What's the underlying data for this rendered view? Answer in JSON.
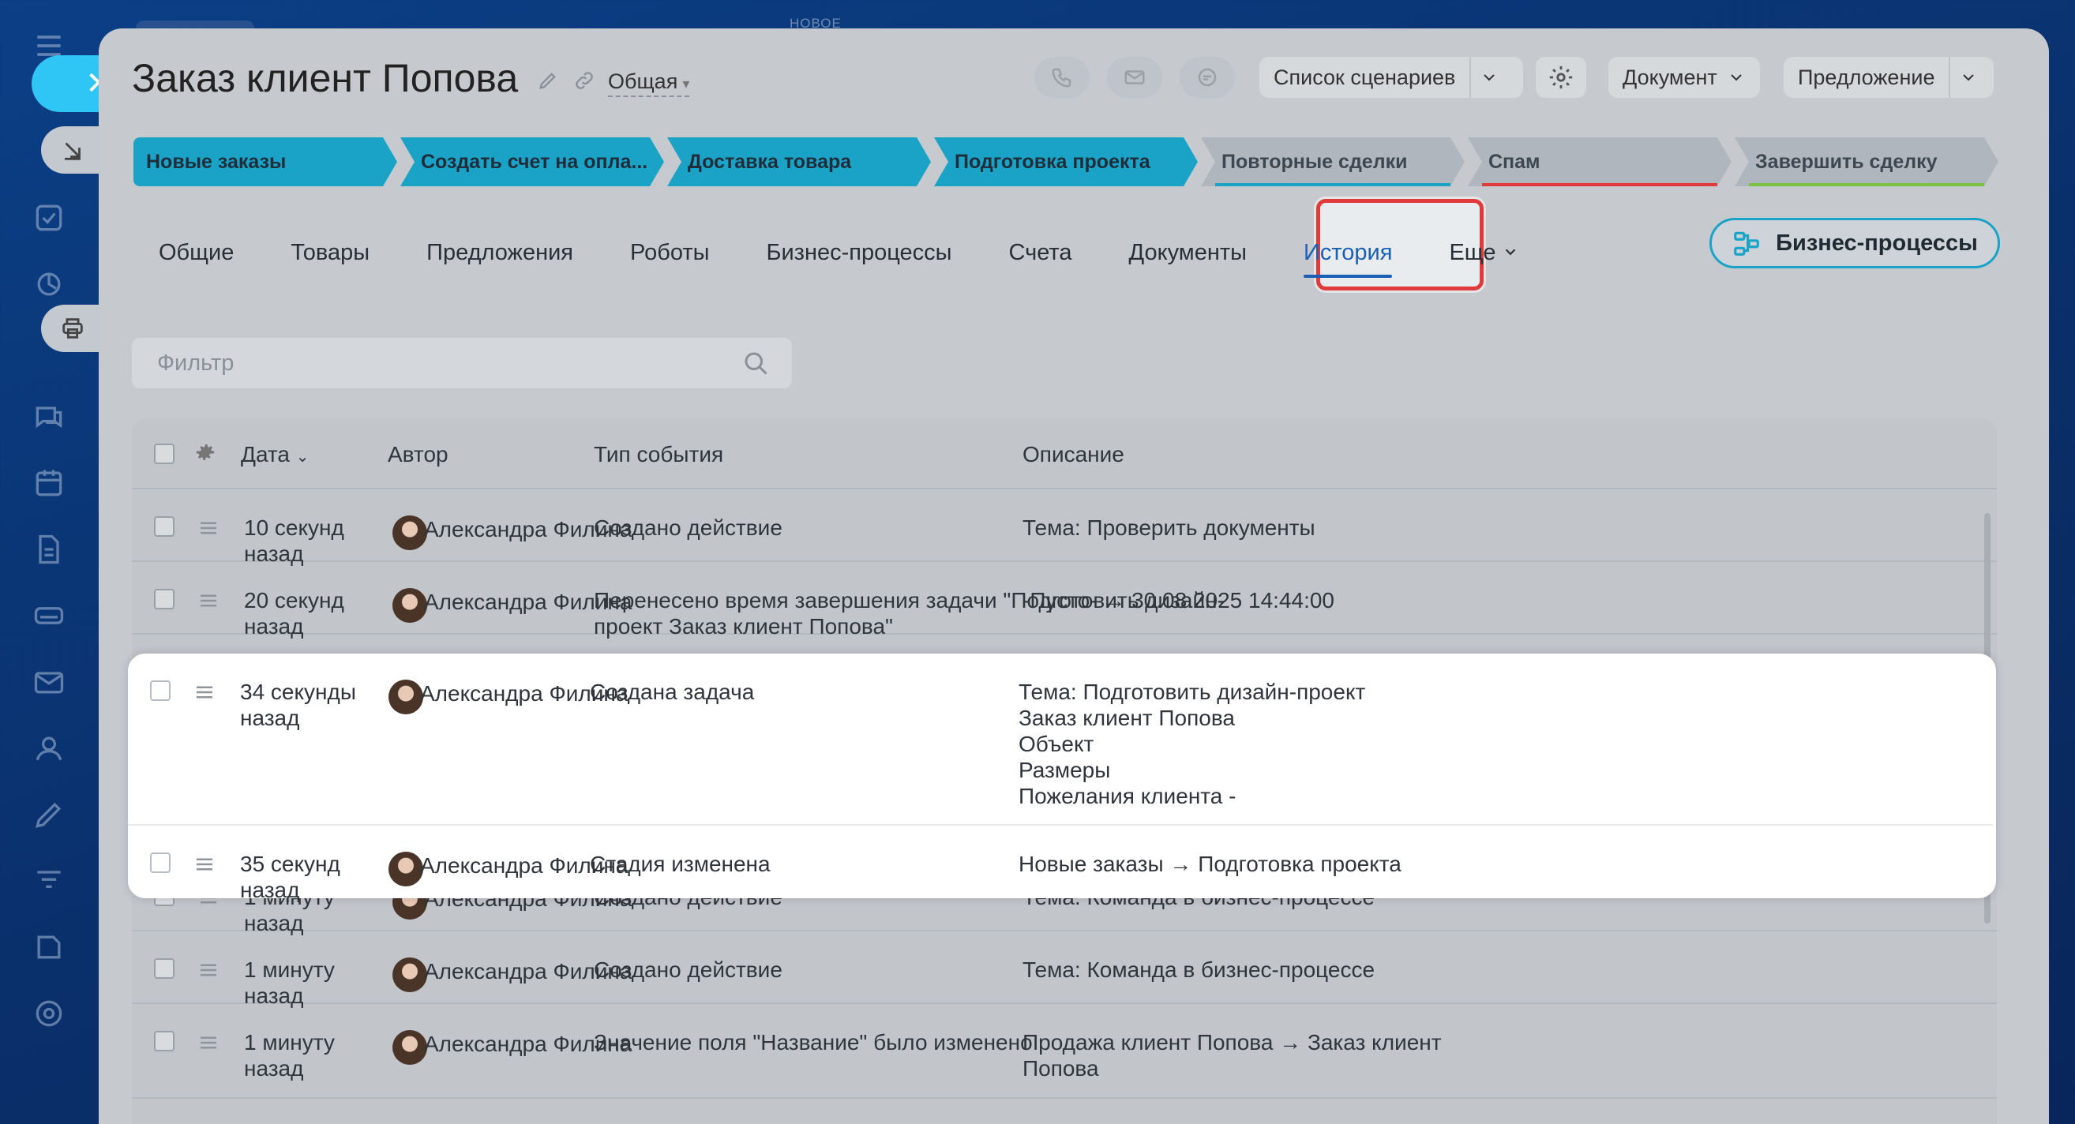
{
  "window": {
    "top_label": "НОВОЕ",
    "title": "Заказ клиент Попова",
    "category": "Общая"
  },
  "header_buttons": {
    "scenarios": "Список сценариев",
    "document": "Документ",
    "proposal": "Предложение"
  },
  "stages": [
    {
      "label": "Новые заказы",
      "state": "active"
    },
    {
      "label": "Создать счет на опла...",
      "state": "active"
    },
    {
      "label": "Доставка товара",
      "state": "active"
    },
    {
      "label": "Подготовка проекта",
      "state": "active"
    },
    {
      "label": "Повторные сделки",
      "state": "inactive",
      "underline": "#1aa3c7"
    },
    {
      "label": "Спам",
      "state": "inactive",
      "underline": "#e03a3a"
    },
    {
      "label": "Завершить сделку",
      "state": "inactive",
      "underline": "#7cc242"
    }
  ],
  "tabs": [
    "Общие",
    "Товары",
    "Предложения",
    "Роботы",
    "Бизнес-процессы",
    "Счета",
    "Документы",
    "История",
    "Еще"
  ],
  "selected_tab": "История",
  "bp_button": "Бизнес-процессы",
  "filter": {
    "placeholder": "Фильтр"
  },
  "table": {
    "columns": [
      "Дата",
      "Автор",
      "Тип события",
      "Описание"
    ],
    "rows": [
      {
        "date": "10 секунд назад",
        "author": "Александра Филина",
        "event": "Создано действие",
        "desc": "Тема: Проверить документы"
      },
      {
        "date": "20 секунд назад",
        "author": "Александра Филина",
        "event": "Перенесено время завершения задачи \"Подготовить дизайн-проект Заказ клиент Попова\"",
        "desc": "-Пусто- → 30.08.2025 14:44:00"
      },
      {
        "date": "34 секунды назад",
        "author": "Александра Филина",
        "event": "Создана задача",
        "desc": "Тема: Подготовить дизайн-проект\nЗаказ клиент Попова\nОбъект\nРазмеры\nПожелания клиента -"
      },
      {
        "date": "35 секунд назад",
        "author": "Александра Филина",
        "event": "Стадия изменена",
        "desc": "Новые заказы → Подготовка проекта"
      },
      {
        "date": "1 минуту назад",
        "author": "Александра Филина",
        "event": "Создано действие",
        "desc": "Тема: Команда в бизнес-процессе"
      },
      {
        "date": "1 минуту назад",
        "author": "Александра Филина",
        "event": "Создано действие",
        "desc": "Тема: Команда в бизнес-процессе"
      },
      {
        "date": "1 минуту назад",
        "author": "Александра Филина",
        "event": "Значение поля \"Название\" было изменено",
        "desc": "Продажа клиент Попова → Заказ клиент Попова"
      }
    ]
  },
  "colors": {
    "accent": "#1aa3c7",
    "link": "#1a5fb4",
    "highlight_border": "#e03a3a"
  }
}
